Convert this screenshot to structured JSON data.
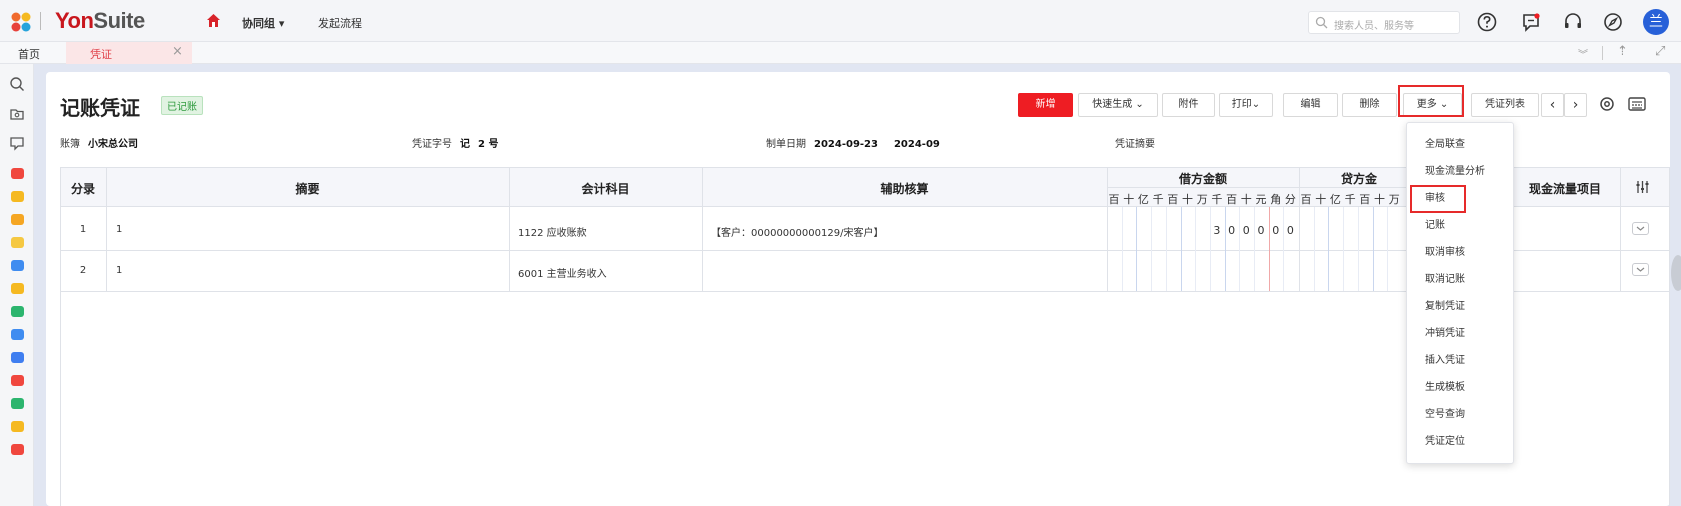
{
  "header": {
    "brand_main": "Yon",
    "brand_suite": "Suite",
    "group_menu": "协同组 ▾",
    "start_flow": "发起流程",
    "search_placeholder": "搜索人员、服务等",
    "avatar_text": "兰"
  },
  "tabs": {
    "home": "首页",
    "active": "凭证"
  },
  "page": {
    "title": "记账凭证",
    "status": "已记账"
  },
  "toolbar": {
    "new": "新增",
    "quick": "快速生成",
    "attach": "附件",
    "print": "打印",
    "edit": "编辑",
    "delete": "删除",
    "more": "更多",
    "list": "凭证列表"
  },
  "info": {
    "book_label": "账簿",
    "book_value": "小宋总公司",
    "voucher_no_label": "凭证字号",
    "voucher_type": "记",
    "voucher_no": "2 号",
    "date_label": "制单日期",
    "date_value": "2024-09-23",
    "period": "2024-09",
    "summary_label": "凭证摘要"
  },
  "table": {
    "headers": {
      "entry": "分录",
      "summary": "摘要",
      "account": "会计科目",
      "aux": "辅助核算",
      "debit": "借方金额",
      "credit": "贷方金",
      "cashflow": "现金流量项目"
    },
    "debit_digits": [
      "百",
      "十",
      "亿",
      "千",
      "百",
      "十",
      "万",
      "千",
      "百",
      "十",
      "元",
      "角",
      "分"
    ],
    "credit_digits": [
      "百",
      "十",
      "亿",
      "千",
      "百",
      "十",
      "万"
    ],
    "rows": [
      {
        "no": "1",
        "summary": "1",
        "account": "1122 应收账款",
        "aux": "【客户：00000000000129/宋客户】",
        "debit_digits": [
          "3",
          "0",
          "0",
          "0",
          "0",
          "0"
        ]
      },
      {
        "no": "2",
        "summary": "1",
        "account": "6001 主营业务收入",
        "aux": "",
        "debit_digits": []
      }
    ]
  },
  "more_menu": {
    "items": [
      "全局联查",
      "现金流量分析",
      "审核",
      "记账",
      "取消审核",
      "取消记账",
      "复制凭证",
      "冲销凭证",
      "插入凭证",
      "生成模板",
      "空号查询",
      "凭证定位"
    ],
    "highlighted": "审核"
  },
  "colors": {
    "accent_red": "#ee1d23",
    "highlight_border": "#e62a2a",
    "status_green": "#2c9a3c",
    "avatar_blue": "#2760d8"
  }
}
